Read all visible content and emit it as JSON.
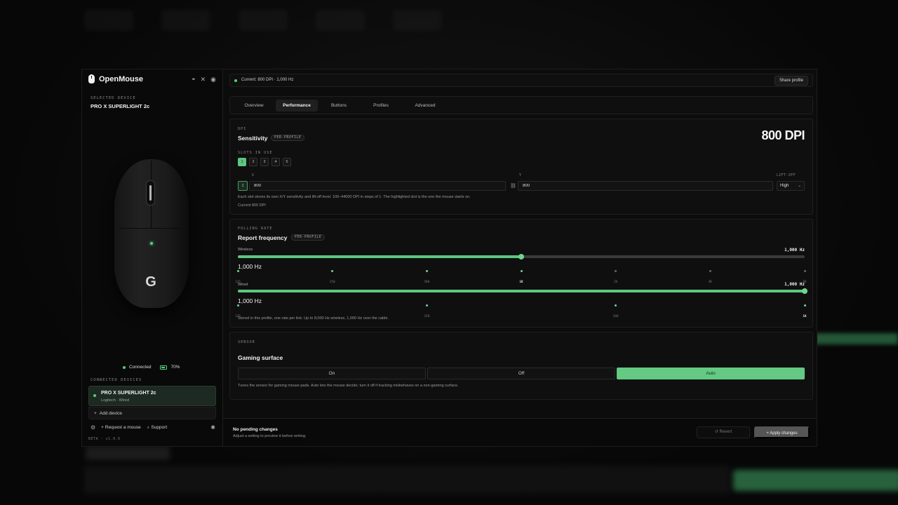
{
  "app": {
    "name": "OpenMouse",
    "version": "BETA · v1.0.0"
  },
  "icons": {
    "socials": [
      "discord-icon",
      "x-icon",
      "github-icon"
    ]
  },
  "sidebar": {
    "selected_label": "SELECTED DEVICE",
    "device_name": "PRO X SUPERLIGHT 2c",
    "status": "Connected",
    "battery": "70%",
    "connected_label": "CONNECTED DEVICES",
    "device_card": {
      "name": "PRO X SUPERLIGHT 2c",
      "sub": "Logitech · Wired"
    },
    "add_device": "Add device",
    "request_mouse": "Request a mouse",
    "support": "Support"
  },
  "topbar": {
    "current": "Current: 800 DPI · 1,000 Hz",
    "share": "Share profile"
  },
  "tabs": [
    "Overview",
    "Performance",
    "Buttons",
    "Profiles",
    "Advanced"
  ],
  "dpi": {
    "label": "DPI",
    "title": "Sensitivity",
    "badge": "PER-PROFILE",
    "value_display": "800 DPI",
    "slots_label": "SLOTS IN USE",
    "slots": [
      "1",
      "2",
      "3",
      "4",
      "5"
    ],
    "active_slot": "1",
    "x_label": "X",
    "y_label": "Y",
    "liftoff_label": "LIFT-OFF",
    "x_value": "800",
    "y_value": "800",
    "liftoff_value": "High",
    "help": "Each slot stores its own X/Y sensitivity and lift-off level. 100–44000 DPI in steps of 1. The highlighted slot is the one the mouse starts on.",
    "current": "Current 800 DPI"
  },
  "polling": {
    "label": "POLLING RATE",
    "title": "Report frequency",
    "badge": "PER-PROFILE",
    "wireless": {
      "name": "Wireless",
      "value": "1,000 Hz",
      "big": "1,000 Hz",
      "fraction": 0.5,
      "ticks": [
        "125",
        "250",
        "500",
        "1K",
        "2K",
        "4K",
        "8K"
      ],
      "selected_tick": "1K"
    },
    "wired": {
      "name": "Wired",
      "value": "1,000 Hz",
      "big": "1,000 Hz",
      "fraction": 1.0,
      "ticks": [
        "125",
        "250",
        "500",
        "1K"
      ],
      "selected_tick": "1K"
    },
    "help": "Stored in this profile, one rate per link. Up to 8,000 Hz wireless, 1,000 Hz over the cable."
  },
  "sensor": {
    "label": "SENSOR",
    "title": "Gaming surface",
    "options": [
      "On",
      "Off",
      "Auto"
    ],
    "selected": "Auto",
    "help": "Tunes the sensor for gaming mouse pads. Auto lets the mouse decide; turn it off if tracking misbehaves on a non-gaming surface."
  },
  "footer": {
    "title": "No pending changes",
    "sub": "Adjust a setting to preview it before writing.",
    "revert": "Revert",
    "apply": "Apply changes"
  },
  "colors": {
    "accent": "#5cc77f",
    "background": "#0b0b0b"
  }
}
